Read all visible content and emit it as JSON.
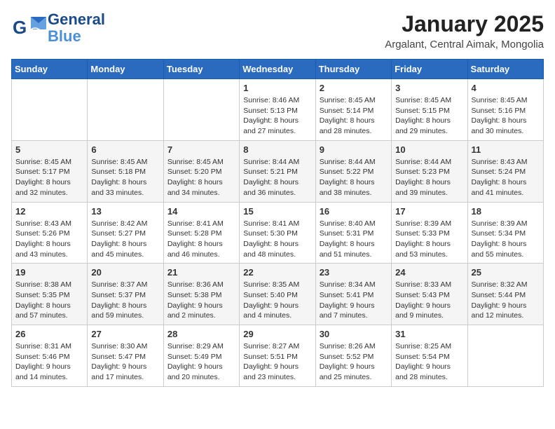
{
  "logo": {
    "line1": "General",
    "line2": "Blue"
  },
  "title": "January 2025",
  "location": "Argalant, Central Aimak, Mongolia",
  "days_header": [
    "Sunday",
    "Monday",
    "Tuesday",
    "Wednesday",
    "Thursday",
    "Friday",
    "Saturday"
  ],
  "weeks": [
    [
      {
        "day": "",
        "info": ""
      },
      {
        "day": "",
        "info": ""
      },
      {
        "day": "",
        "info": ""
      },
      {
        "day": "1",
        "info": "Sunrise: 8:46 AM\nSunset: 5:13 PM\nDaylight: 8 hours and 27 minutes."
      },
      {
        "day": "2",
        "info": "Sunrise: 8:45 AM\nSunset: 5:14 PM\nDaylight: 8 hours and 28 minutes."
      },
      {
        "day": "3",
        "info": "Sunrise: 8:45 AM\nSunset: 5:15 PM\nDaylight: 8 hours and 29 minutes."
      },
      {
        "day": "4",
        "info": "Sunrise: 8:45 AM\nSunset: 5:16 PM\nDaylight: 8 hours and 30 minutes."
      }
    ],
    [
      {
        "day": "5",
        "info": "Sunrise: 8:45 AM\nSunset: 5:17 PM\nDaylight: 8 hours and 32 minutes."
      },
      {
        "day": "6",
        "info": "Sunrise: 8:45 AM\nSunset: 5:18 PM\nDaylight: 8 hours and 33 minutes."
      },
      {
        "day": "7",
        "info": "Sunrise: 8:45 AM\nSunset: 5:20 PM\nDaylight: 8 hours and 34 minutes."
      },
      {
        "day": "8",
        "info": "Sunrise: 8:44 AM\nSunset: 5:21 PM\nDaylight: 8 hours and 36 minutes."
      },
      {
        "day": "9",
        "info": "Sunrise: 8:44 AM\nSunset: 5:22 PM\nDaylight: 8 hours and 38 minutes."
      },
      {
        "day": "10",
        "info": "Sunrise: 8:44 AM\nSunset: 5:23 PM\nDaylight: 8 hours and 39 minutes."
      },
      {
        "day": "11",
        "info": "Sunrise: 8:43 AM\nSunset: 5:24 PM\nDaylight: 8 hours and 41 minutes."
      }
    ],
    [
      {
        "day": "12",
        "info": "Sunrise: 8:43 AM\nSunset: 5:26 PM\nDaylight: 8 hours and 43 minutes."
      },
      {
        "day": "13",
        "info": "Sunrise: 8:42 AM\nSunset: 5:27 PM\nDaylight: 8 hours and 45 minutes."
      },
      {
        "day": "14",
        "info": "Sunrise: 8:41 AM\nSunset: 5:28 PM\nDaylight: 8 hours and 46 minutes."
      },
      {
        "day": "15",
        "info": "Sunrise: 8:41 AM\nSunset: 5:30 PM\nDaylight: 8 hours and 48 minutes."
      },
      {
        "day": "16",
        "info": "Sunrise: 8:40 AM\nSunset: 5:31 PM\nDaylight: 8 hours and 51 minutes."
      },
      {
        "day": "17",
        "info": "Sunrise: 8:39 AM\nSunset: 5:33 PM\nDaylight: 8 hours and 53 minutes."
      },
      {
        "day": "18",
        "info": "Sunrise: 8:39 AM\nSunset: 5:34 PM\nDaylight: 8 hours and 55 minutes."
      }
    ],
    [
      {
        "day": "19",
        "info": "Sunrise: 8:38 AM\nSunset: 5:35 PM\nDaylight: 8 hours and 57 minutes."
      },
      {
        "day": "20",
        "info": "Sunrise: 8:37 AM\nSunset: 5:37 PM\nDaylight: 8 hours and 59 minutes."
      },
      {
        "day": "21",
        "info": "Sunrise: 8:36 AM\nSunset: 5:38 PM\nDaylight: 9 hours and 2 minutes."
      },
      {
        "day": "22",
        "info": "Sunrise: 8:35 AM\nSunset: 5:40 PM\nDaylight: 9 hours and 4 minutes."
      },
      {
        "day": "23",
        "info": "Sunrise: 8:34 AM\nSunset: 5:41 PM\nDaylight: 9 hours and 7 minutes."
      },
      {
        "day": "24",
        "info": "Sunrise: 8:33 AM\nSunset: 5:43 PM\nDaylight: 9 hours and 9 minutes."
      },
      {
        "day": "25",
        "info": "Sunrise: 8:32 AM\nSunset: 5:44 PM\nDaylight: 9 hours and 12 minutes."
      }
    ],
    [
      {
        "day": "26",
        "info": "Sunrise: 8:31 AM\nSunset: 5:46 PM\nDaylight: 9 hours and 14 minutes."
      },
      {
        "day": "27",
        "info": "Sunrise: 8:30 AM\nSunset: 5:47 PM\nDaylight: 9 hours and 17 minutes."
      },
      {
        "day": "28",
        "info": "Sunrise: 8:29 AM\nSunset: 5:49 PM\nDaylight: 9 hours and 20 minutes."
      },
      {
        "day": "29",
        "info": "Sunrise: 8:27 AM\nSunset: 5:51 PM\nDaylight: 9 hours and 23 minutes."
      },
      {
        "day": "30",
        "info": "Sunrise: 8:26 AM\nSunset: 5:52 PM\nDaylight: 9 hours and 25 minutes."
      },
      {
        "day": "31",
        "info": "Sunrise: 8:25 AM\nSunset: 5:54 PM\nDaylight: 9 hours and 28 minutes."
      },
      {
        "day": "",
        "info": ""
      }
    ]
  ]
}
